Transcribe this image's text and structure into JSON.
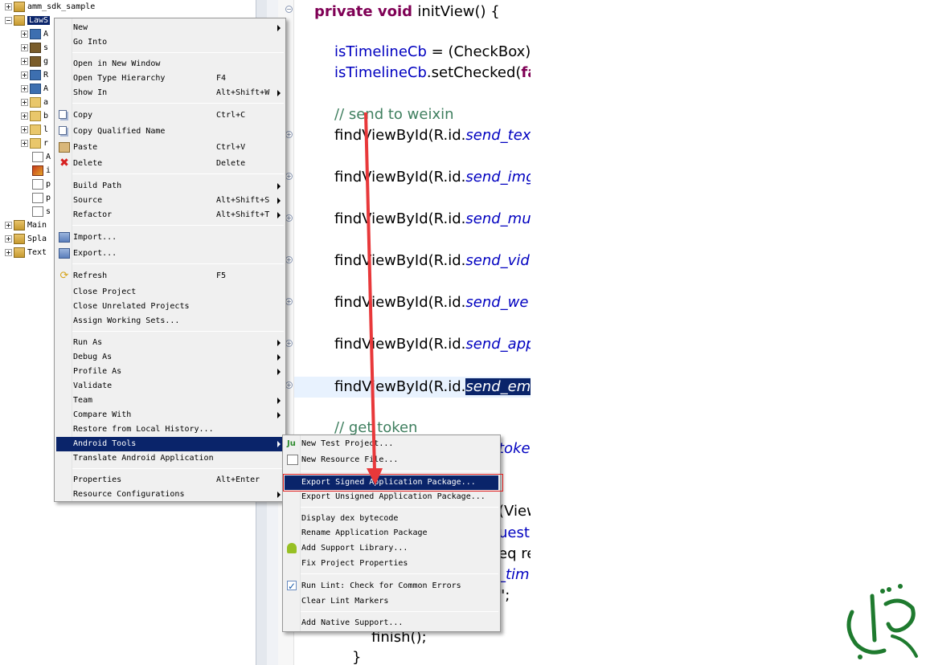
{
  "tree": {
    "items": [
      {
        "label": "amm_sdk_sample",
        "icon": "project-icon",
        "toggle": "plus"
      },
      {
        "label": "LawS",
        "icon": "project-icon",
        "toggle": "minus",
        "selected": true
      },
      {
        "label": "A",
        "icon": "library-icon",
        "toggle": "plus"
      },
      {
        "label": "s",
        "icon": "package-icon",
        "toggle": "plus"
      },
      {
        "label": "g",
        "icon": "package-icon",
        "toggle": "plus"
      },
      {
        "label": "R",
        "icon": "library-icon",
        "toggle": "plus"
      },
      {
        "label": "A",
        "icon": "library-icon",
        "toggle": "plus"
      },
      {
        "label": "a",
        "icon": "folder-icon",
        "toggle": "plus"
      },
      {
        "label": "b",
        "icon": "folder-icon",
        "toggle": "plus"
      },
      {
        "label": "l",
        "icon": "folder-icon",
        "toggle": "plus"
      },
      {
        "label": "r",
        "icon": "folder-icon",
        "toggle": "plus"
      },
      {
        "label": "A",
        "icon": "file-icon",
        "toggle": "none"
      },
      {
        "label": "i",
        "icon": "image-icon",
        "toggle": "none"
      },
      {
        "label": "p",
        "icon": "file-icon",
        "toggle": "none"
      },
      {
        "label": "p",
        "icon": "file-icon",
        "toggle": "none"
      },
      {
        "label": "s",
        "icon": "file-icon",
        "toggle": "none"
      },
      {
        "label": "Main",
        "icon": "project-icon",
        "toggle": "plus"
      },
      {
        "label": "Spla",
        "icon": "project-icon",
        "toggle": "plus"
      },
      {
        "label": "Text",
        "icon": "project-icon",
        "toggle": "plus"
      }
    ]
  },
  "editor": {
    "lines": {
      "l1_kw": "private void ",
      "l1_rest": "initView() {",
      "l2_field": "isTimelineCb",
      "l2_rest": " = (CheckBox)",
      "l3_field": "isTimelineCb",
      "l3_rest": ".setChecked(",
      "l3_kw": "fa",
      "l4_comment": "// send to weixin",
      "l5_a": "findViewById(R.id.",
      "l5_b": "send_tex",
      "l6_a": "findViewById(R.id.",
      "l6_b": "send_img",
      "l7_a": "findViewById(R.id.",
      "l7_b": "send_mu",
      "l8_a": "findViewById(R.id.",
      "l8_b": "send_vid",
      "l9_a": "findViewById(R.id.",
      "l9_b": "send_we",
      "l10_a": "findViewById(R.id.",
      "l10_b": "send_app",
      "l11_a": "findViewById(R.id.",
      "l11_b": "send_em",
      "l12_comment": "// get token",
      "l13_b": "toke",
      "l14_rest": "(View",
      "l15_b": "uest",
      "l16_rest": "eq re",
      "l17_b": "_tim",
      "l18_rest": "\";",
      "l19": "finish();",
      "l20": "}"
    }
  },
  "context_menu": {
    "items": {
      "new": "New",
      "go_into": "Go Into",
      "open_new_window": "Open in New Window",
      "open_type_hierarchy": "Open Type Hierarchy",
      "open_type_hierarchy_acc": "F4",
      "show_in": "Show In",
      "show_in_acc": "Alt+Shift+W",
      "copy": "Copy",
      "copy_acc": "Ctrl+C",
      "copy_qualified": "Copy Qualified Name",
      "paste": "Paste",
      "paste_acc": "Ctrl+V",
      "delete": "Delete",
      "delete_acc": "Delete",
      "build_path": "Build Path",
      "source": "Source",
      "source_acc": "Alt+Shift+S",
      "refactor": "Refactor",
      "refactor_acc": "Alt+Shift+T",
      "import": "Import...",
      "export": "Export...",
      "refresh": "Refresh",
      "refresh_acc": "F5",
      "close_project": "Close Project",
      "close_unrelated": "Close Unrelated Projects",
      "assign_working_sets": "Assign Working Sets...",
      "run_as": "Run As",
      "debug_as": "Debug As",
      "profile_as": "Profile As",
      "validate": "Validate",
      "team": "Team",
      "compare_with": "Compare With",
      "restore_local_history": "Restore from Local History...",
      "android_tools": "Android Tools",
      "translate_android": "Translate Android Application",
      "properties": "Properties",
      "properties_acc": "Alt+Enter",
      "resource_configurations": "Resource Configurations"
    }
  },
  "submenu": {
    "items": {
      "new_test_project": "New Test Project...",
      "new_resource_file": "New Resource File...",
      "export_signed": "Export Signed Application Package...",
      "export_unsigned": "Export Unsigned Application Package...",
      "display_dex": "Display dex bytecode",
      "rename_package": "Rename Application Package",
      "add_support_library": "Add Support Library...",
      "fix_project_properties": "Fix Project Properties",
      "run_lint": "Run Lint: Check for Common Errors",
      "clear_lint": "Clear Lint Markers",
      "add_native_support": "Add Native Support..."
    }
  },
  "annotation": {
    "arrow_color": "#e8383a",
    "box_color": "#e02020"
  },
  "colors": {
    "menu_selection": "#0a246a",
    "keyword": "#7f0055",
    "field": "#0000c0",
    "comment": "#3f7f5f"
  }
}
